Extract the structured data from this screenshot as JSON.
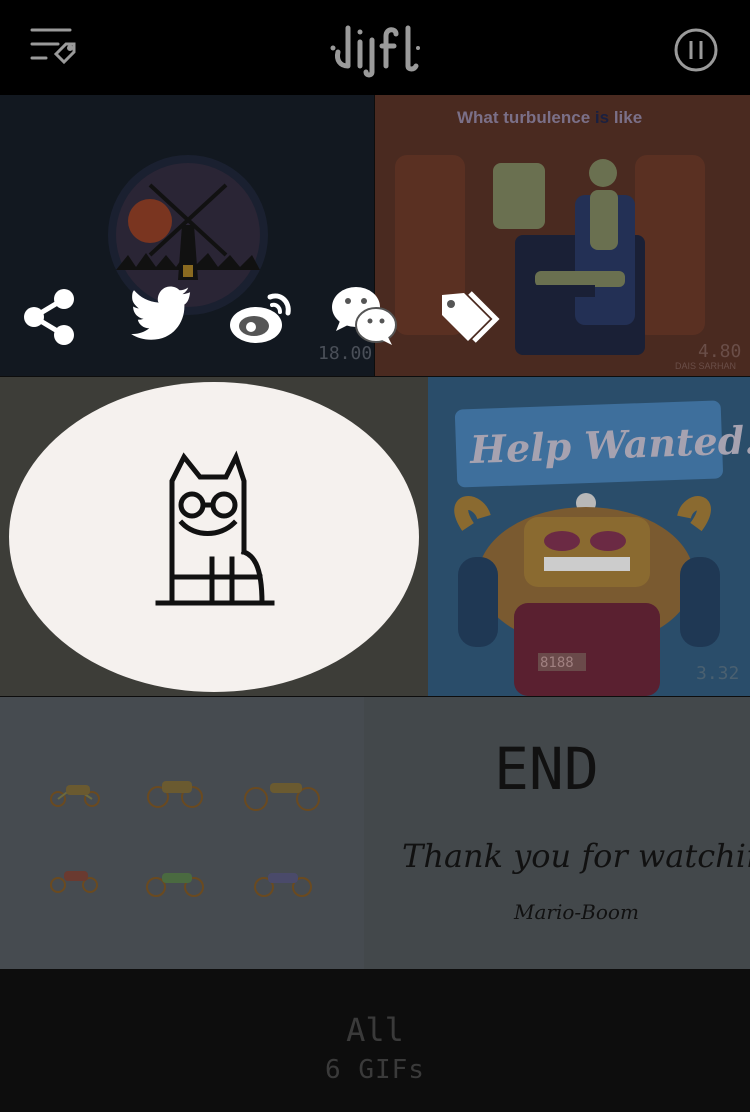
{
  "header": {
    "logo_text": "djifd",
    "menu_icon": "playlist-tag-icon",
    "pause_icon": "pause-circle-icon"
  },
  "gifs": [
    {
      "name": "windmill",
      "timestamp": "18.00"
    },
    {
      "name": "turbulence",
      "title_part1": "What turbulence ",
      "title_part2": "is",
      "title_part3": " like",
      "timestamp": "4.80",
      "credit": "DAIS SARHAN"
    },
    {
      "name": "cat",
      "selected": true
    },
    {
      "name": "help-wanted",
      "sign_text": "Help Wanted!",
      "timestamp": "3.32",
      "counter": "8188"
    },
    {
      "name": "motorcycles"
    },
    {
      "name": "end-card",
      "title": "END",
      "message": "Thank you for watching !!",
      "author": "Mario-Boom"
    }
  ],
  "share": {
    "icons": [
      "share-icon",
      "twitter-icon",
      "weibo-icon",
      "wechat-icon",
      "tag-icon"
    ]
  },
  "footer": {
    "category": "All",
    "count_label": "6 GIFs"
  },
  "colors": {
    "background": "#000000",
    "icon_gray": "#9a9a9a",
    "selection_bg": "#f5f1ee"
  }
}
